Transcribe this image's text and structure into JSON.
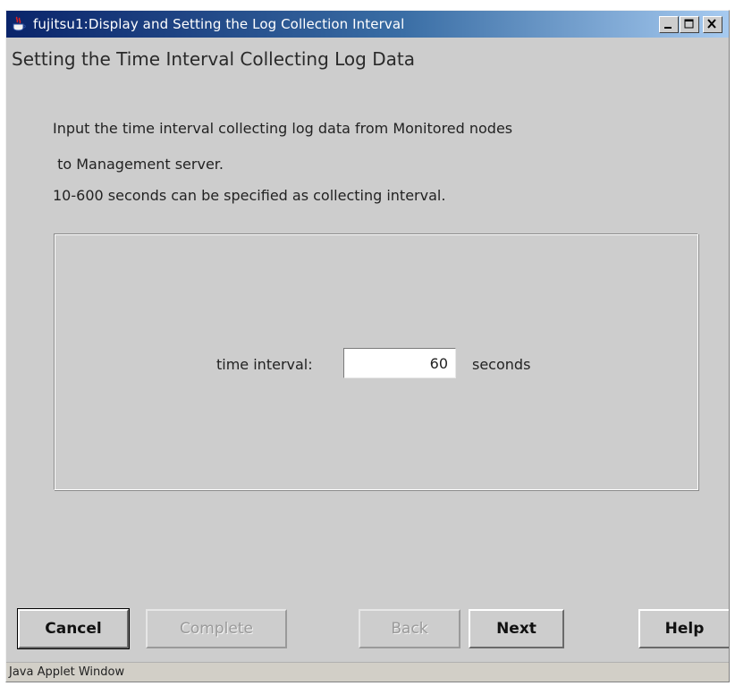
{
  "window": {
    "title": "fujitsu1:Display and Setting the Log Collection Interval",
    "icon": "java-cup-icon",
    "controls": [
      "minimize-icon",
      "maximize-icon",
      "close-icon"
    ]
  },
  "heading": "Setting the Time Interval Collecting Log Data",
  "description": {
    "line1": "Input the time interval collecting log data from Monitored nodes",
    "line2": " to Management server.",
    "line3": "10-600 seconds can be specified as collecting interval."
  },
  "form": {
    "label": "time interval:",
    "value": "60",
    "unit": "seconds"
  },
  "buttons": {
    "cancel": "Cancel",
    "complete": "Complete",
    "back": "Back",
    "next": "Next",
    "help": "Help"
  },
  "status": "Java Applet Window",
  "colors": {
    "background": "#cdcdcd",
    "titlebar_start": "#0a246a",
    "titlebar_end": "#a6caf0"
  }
}
